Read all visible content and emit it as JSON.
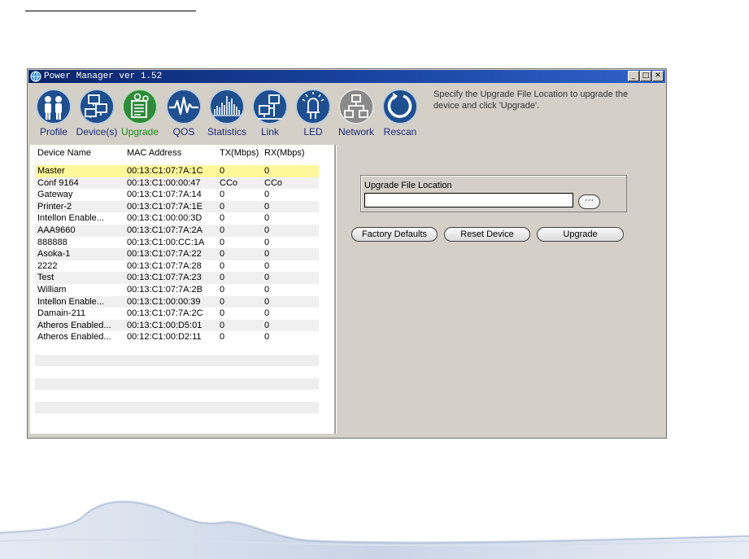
{
  "window": {
    "title": "Power Manager ver 1.52",
    "controls": {
      "minimize": "_",
      "maximize": "□",
      "close": "✕"
    }
  },
  "toolbar": {
    "items": [
      {
        "label": "Profile",
        "icon": "people-icon",
        "active": false
      },
      {
        "label": "Device(s)",
        "icon": "computers-icon",
        "active": false
      },
      {
        "label": "Upgrade",
        "icon": "upgrade-icon",
        "active": true
      },
      {
        "label": "QOS",
        "icon": "waveform-icon",
        "active": false
      },
      {
        "label": "Statistics",
        "icon": "bars-icon",
        "active": false
      },
      {
        "label": "Link",
        "icon": "link-icon",
        "active": false
      },
      {
        "label": "LED",
        "icon": "led-icon",
        "active": false
      },
      {
        "label": "Network",
        "icon": "network-icon",
        "active": false
      },
      {
        "label": "Rescan",
        "icon": "rescan-icon",
        "active": false
      }
    ]
  },
  "hint": "Specify the Upgrade File Location to upgrade the device and click 'Upgrade'.",
  "devices": {
    "columns": [
      "Device Name",
      "MAC Address",
      "TX(Mbps)",
      "RX(Mbps)"
    ],
    "rows": [
      [
        "Master",
        "00:13:C1:07:7A:1C",
        "0",
        "0"
      ],
      [
        "Conf 9164",
        "00:13:C1:00:00:47",
        "CCo",
        "CCo"
      ],
      [
        "Gateway",
        "00:13:C1:07:7A:14",
        "0",
        "0"
      ],
      [
        "Printer-2",
        "00:13:C1:07:7A:1E",
        "0",
        "0"
      ],
      [
        "Intellon Enable...",
        "00:13:C1:00:00:3D",
        "0",
        "0"
      ],
      [
        "AAA9660",
        "00:13:C1:07:7A:2A",
        "0",
        "0"
      ],
      [
        "888888",
        "00:13:C1:00:CC:1A",
        "0",
        "0"
      ],
      [
        "Asoka-1",
        "00:13:C1:07:7A:22",
        "0",
        "0"
      ],
      [
        "2222",
        "00:13:C1:07:7A:28",
        "0",
        "0"
      ],
      [
        "Test",
        "00:13:C1:07:7A:23",
        "0",
        "0"
      ],
      [
        "William",
        "00:13:C1:07:7A:2B",
        "0",
        "0"
      ],
      [
        "Intellon Enable...",
        "00:13:C1:00:00:39",
        "0",
        "0"
      ],
      [
        "Damain-211",
        "00:13:C1:07:7A:2C",
        "0",
        "0"
      ],
      [
        "Atheros Enabled...",
        "00:13:C1:00:D5:01",
        "0",
        "0"
      ],
      [
        "Atheros Enabled...",
        "00:12:C1:00:D2:11",
        "0",
        "0"
      ]
    ]
  },
  "upgrade": {
    "group_label": "Upgrade File Location",
    "file_path": "",
    "browse_label": "···",
    "factory_defaults_label": "Factory Defaults",
    "reset_device_label": "Reset Device",
    "upgrade_label": "Upgrade"
  },
  "colors": {
    "icon_blue": "#1f4f8f",
    "icon_green": "#2e8b3a",
    "icon_gray": "#8a8a8a",
    "selected_row": "#fff79a"
  }
}
